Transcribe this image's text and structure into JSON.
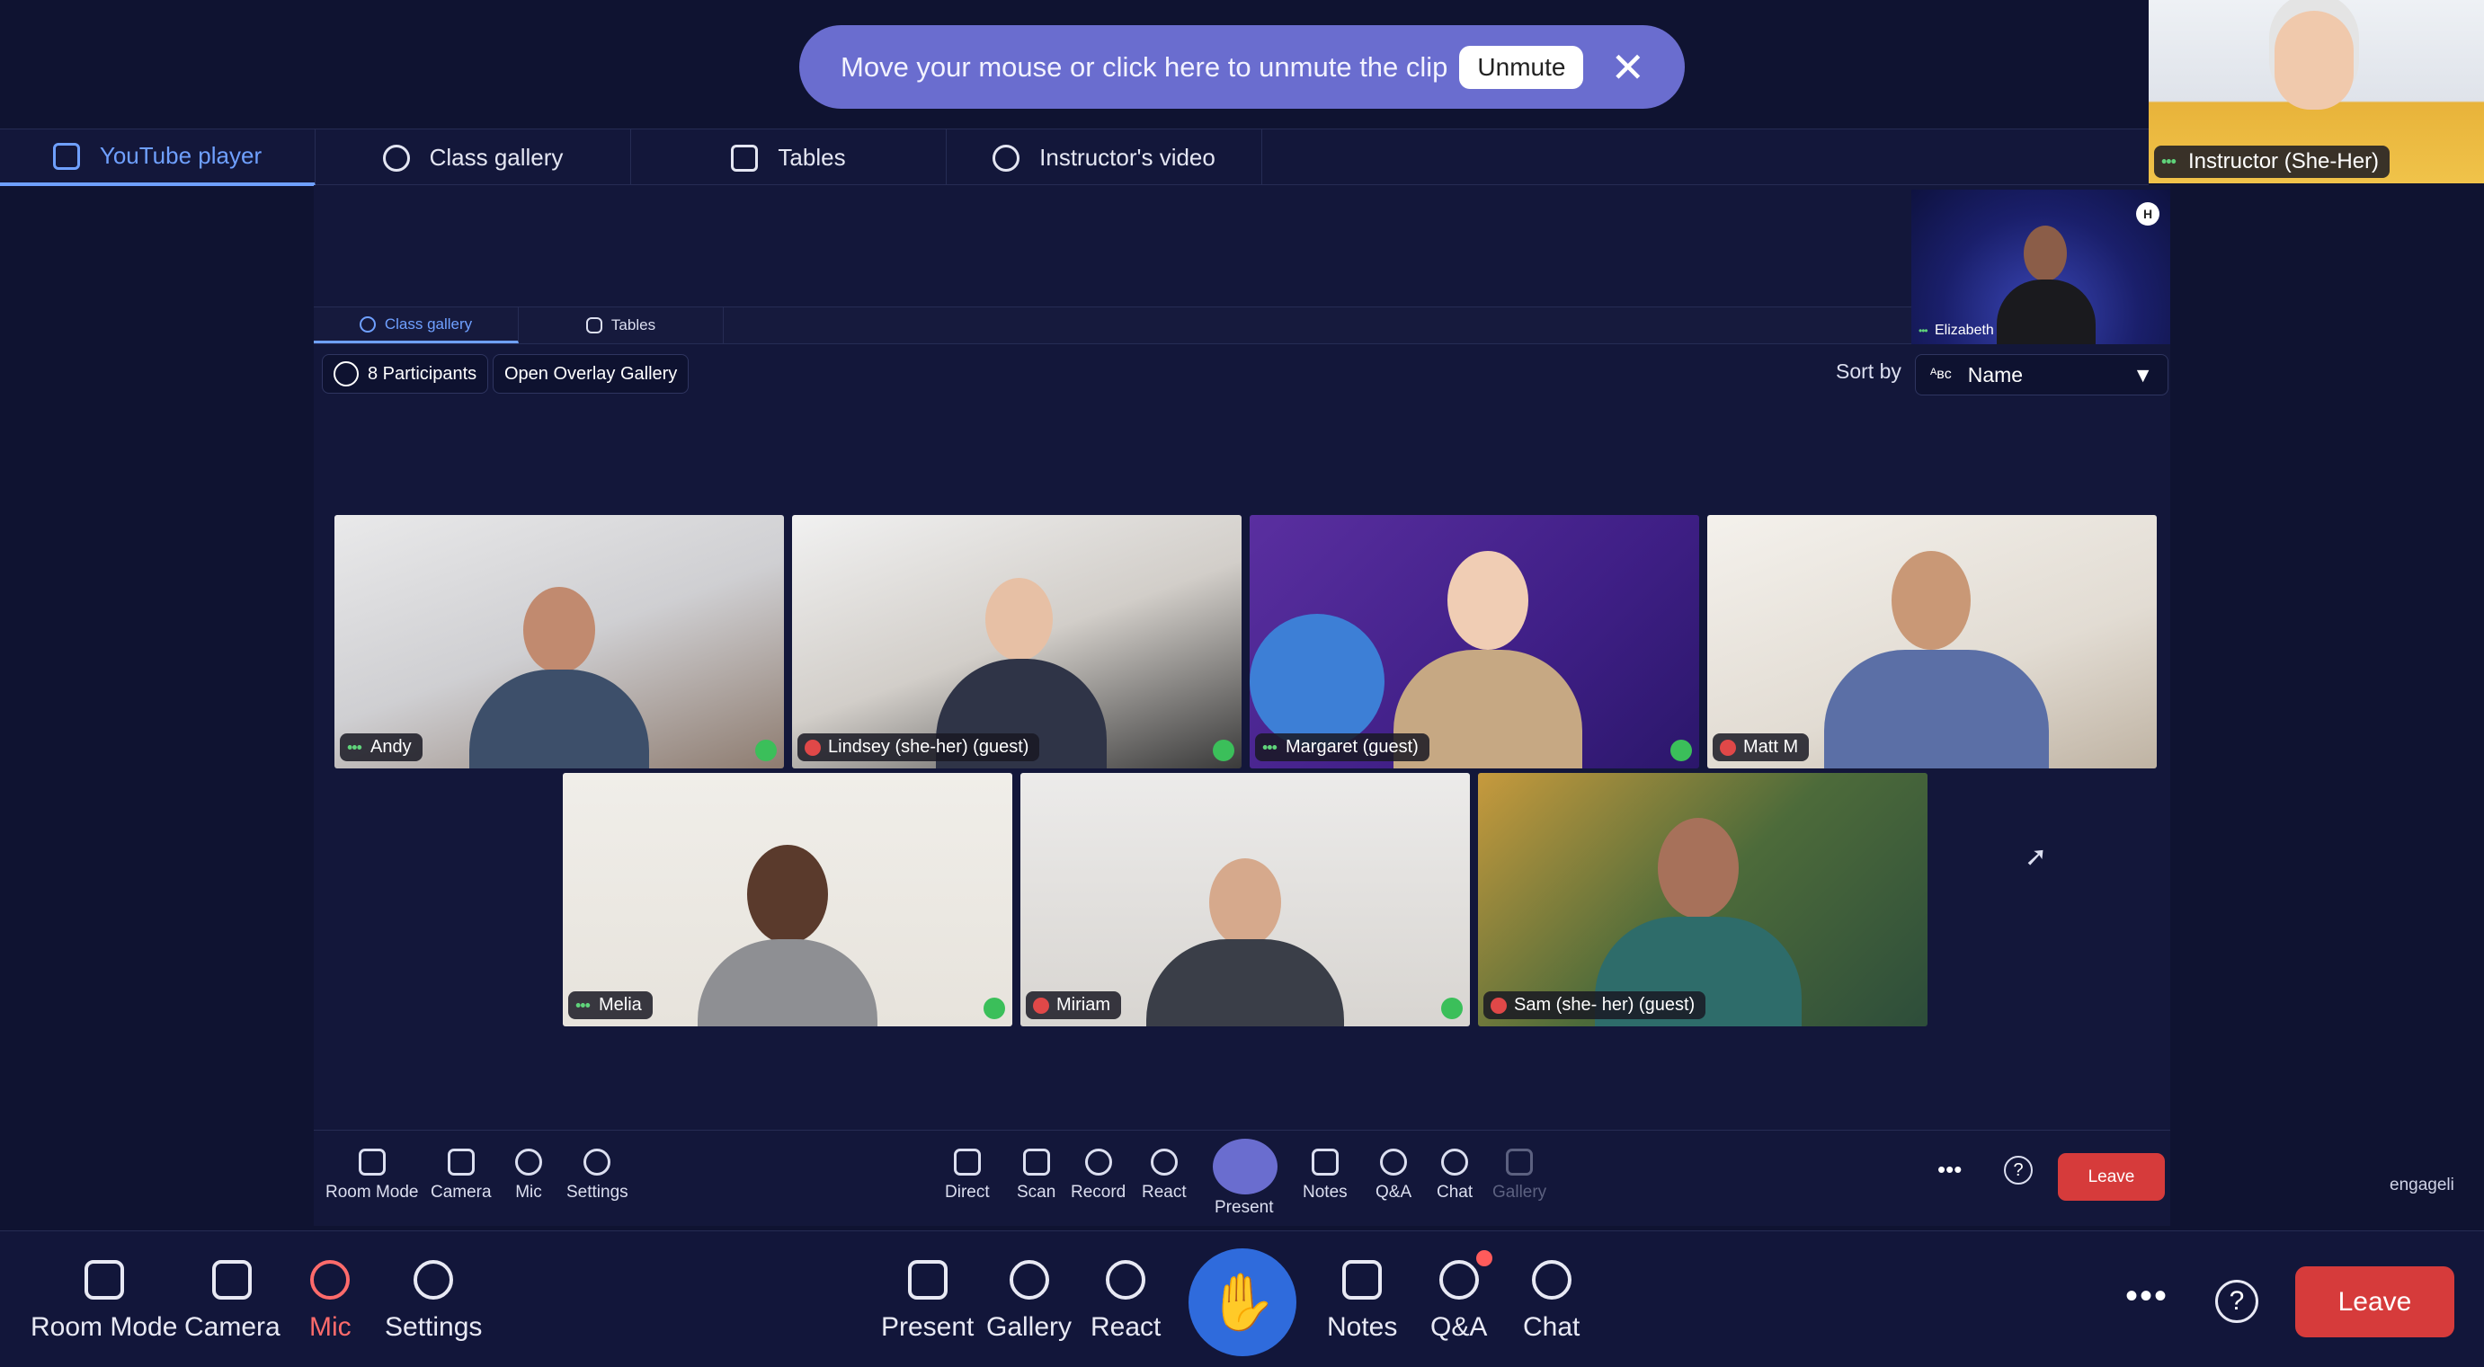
{
  "banner": {
    "message": "Move your mouse or click here to unmute the clip",
    "unmute_label": "Unmute"
  },
  "instructor": {
    "label": "Instructor (She-Her)"
  },
  "tabs": [
    {
      "label": "YouTube player",
      "icon": "play-icon",
      "active": true
    },
    {
      "label": "Class gallery",
      "icon": "grid-icon",
      "active": false
    },
    {
      "label": "Tables",
      "icon": "tables-icon",
      "active": false
    },
    {
      "label": "Instructor's video",
      "icon": "face-icon",
      "active": false
    }
  ],
  "inner": {
    "tabs": [
      {
        "label": "Class gallery"
      },
      {
        "label": "Tables"
      }
    ],
    "participants_label": "8 Participants",
    "overlay_label": "Open Overlay Gallery",
    "sort_label": "Sort by",
    "sort_value": "Name",
    "elizabeth_label": "Elizabeth"
  },
  "participants": [
    {
      "name": "Andy",
      "muted": false
    },
    {
      "name": "Lindsey (she-her) (guest)",
      "muted": true
    },
    {
      "name": "Margaret (guest)",
      "muted": false
    },
    {
      "name": "Matt M",
      "muted": true
    },
    {
      "name": "Melia",
      "muted": false
    },
    {
      "name": "Miriam",
      "muted": true
    },
    {
      "name": "Sam (she- her) (guest)",
      "muted": true
    }
  ],
  "inner_toolbar": {
    "room_mode": "Room Mode",
    "camera": "Camera",
    "mic": "Mic",
    "settings": "Settings",
    "direct": "Direct",
    "scan": "Scan",
    "record": "Record",
    "react": "React",
    "present": "Present",
    "notes": "Notes",
    "qa": "Q&A",
    "chat": "Chat",
    "gallery": "Gallery",
    "leave": "Leave",
    "brand": "engageli"
  },
  "toolbar": {
    "room_mode": "Room Mode",
    "camera": "Camera",
    "mic": "Mic",
    "settings": "Settings",
    "present": "Present",
    "gallery": "Gallery",
    "react": "React",
    "notes": "Notes",
    "qa": "Q&A",
    "chat": "Chat",
    "leave": "Leave"
  },
  "colors": {
    "accent": "#6a6dcf",
    "active_tab": "#6fa0ff",
    "leave": "#d63b3b",
    "hand": "#2f6bdc",
    "mic_muted": "#ff6b6b"
  }
}
